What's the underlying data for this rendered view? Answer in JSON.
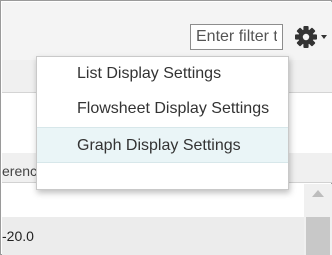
{
  "toolbar": {
    "filter_placeholder": "Enter filter text...",
    "settings_icon": "gear-icon",
    "dropdown_icon": "caret-down-icon"
  },
  "menu": {
    "items": [
      {
        "label": "List Display Settings"
      },
      {
        "label": "Flowsheet Display Settings"
      },
      {
        "label": "Graph Display Settings",
        "highlighted": true
      }
    ]
  },
  "table": {
    "column_header": "erence Range",
    "rows": [
      {
        "value": ""
      },
      {
        "value": "-20.0"
      }
    ]
  },
  "colors": {
    "menu_highlight": "#eaf5f7",
    "toolbar_bg": "#f4f4f4",
    "header_bg": "#f0f0f0"
  }
}
